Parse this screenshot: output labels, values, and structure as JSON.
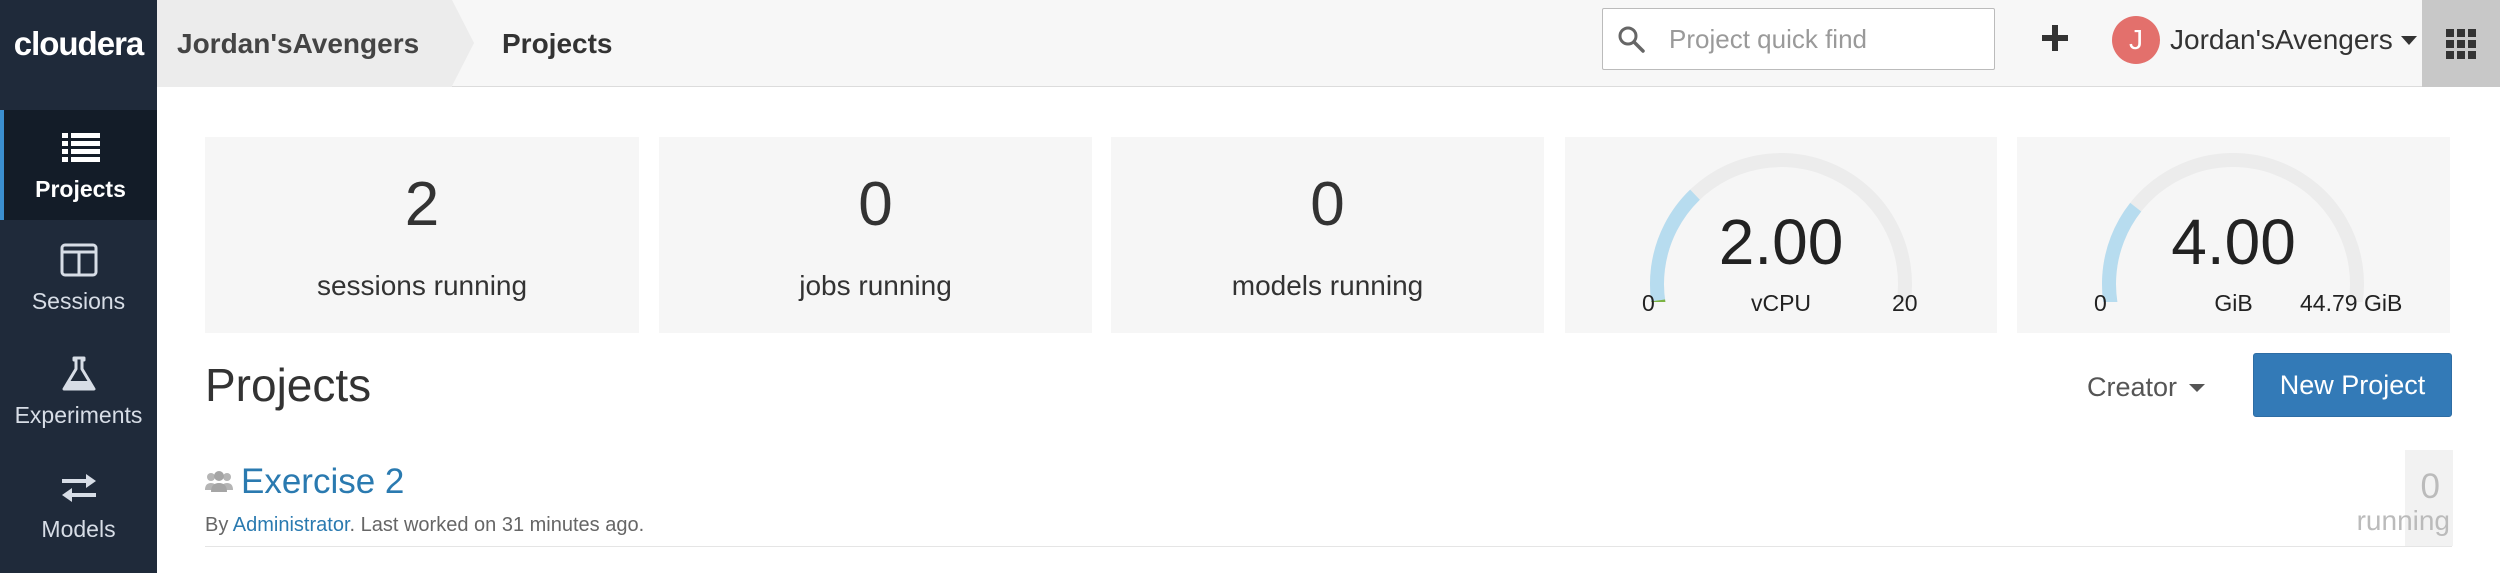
{
  "brand": {
    "logo": "cloudera"
  },
  "sidebar": {
    "items": [
      {
        "label": "Projects",
        "icon": "list-icon",
        "active": true
      },
      {
        "label": "Sessions",
        "icon": "sessions-icon",
        "active": false
      },
      {
        "label": "Experiments",
        "icon": "flask-icon",
        "active": false
      },
      {
        "label": "Models",
        "icon": "arrows-icon",
        "active": false
      }
    ]
  },
  "header": {
    "team": "Jordan'sAvengers",
    "page": "Projects",
    "search": {
      "placeholder": "Project quick find",
      "value": ""
    },
    "user": {
      "initial": "J",
      "name": "Jordan'sAvengers"
    }
  },
  "stats": {
    "sessions": {
      "value": "2",
      "label": "sessions running"
    },
    "jobs": {
      "value": "0",
      "label": "jobs running"
    },
    "models": {
      "value": "0",
      "label": "models running"
    },
    "vcpu": {
      "value": "2.00",
      "unit": "vCPU",
      "min": "0",
      "max": "20",
      "fraction": 0.1
    },
    "memory": {
      "value": "4.00",
      "unit": "GiB",
      "min": "0",
      "max": "44.79 GiB",
      "fraction": 0.09
    }
  },
  "projects_section": {
    "title": "Projects",
    "filter_label": "Creator",
    "new_button": "New Project",
    "items": [
      {
        "name": "Exercise 2",
        "by_prefix": "By",
        "creator": "Administrator",
        "last_worked": ". Last worked on 31 minutes ago.",
        "count": "0",
        "count_label": "running"
      }
    ]
  },
  "colors": {
    "accent": "#337ab7",
    "sidebar": "#1f2a3a",
    "gauge_used": "#7cb342",
    "gauge_range": "#b7dcef",
    "avatar": "#e3706c"
  }
}
